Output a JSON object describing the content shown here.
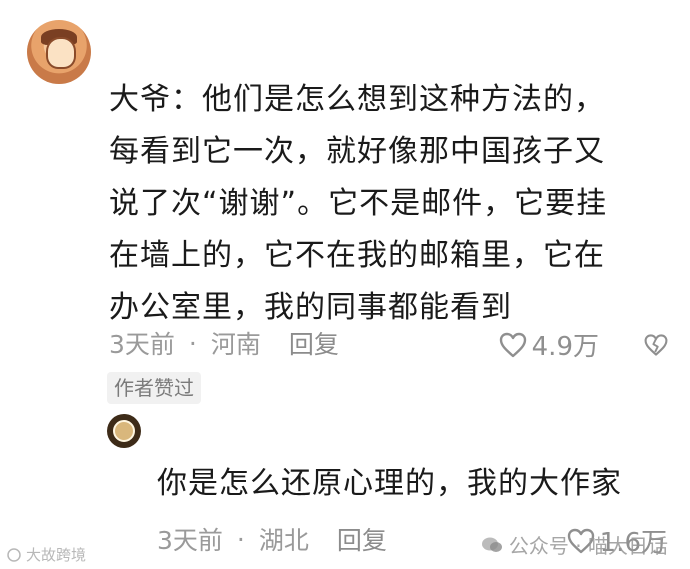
{
  "comment": {
    "lines": [
      "大爷：他们是怎么想到这种方法的，",
      "每看到它一次，就好像那中国孩子又",
      "说了次“谢谢”。它不是邮件，它要挂",
      "在墙上的，它不在我的邮箱里，它在",
      "办公室里，我的同事都能看到"
    ],
    "time": "3天前",
    "separator": "·",
    "location": "河南",
    "reply_label": "回复",
    "likes": "4.9万",
    "author_badge": "作者赞过"
  },
  "reply": {
    "text": "你是怎么还原心理的，我的大作家",
    "time": "3天前",
    "separator": "·",
    "location": "湖北",
    "reply_label": "回复",
    "likes": "1.6万"
  },
  "watermarks": {
    "left": "大故跨境",
    "right": "公众号 · 喵大日话"
  },
  "icons": {
    "like": "heart-outline-icon",
    "dislike": "broken-heart-icon",
    "wechat": "wechat-icon"
  },
  "colors": {
    "text": "#1a1a1a",
    "meta": "#9a9a9a",
    "badge_bg": "#f1f1f1"
  }
}
